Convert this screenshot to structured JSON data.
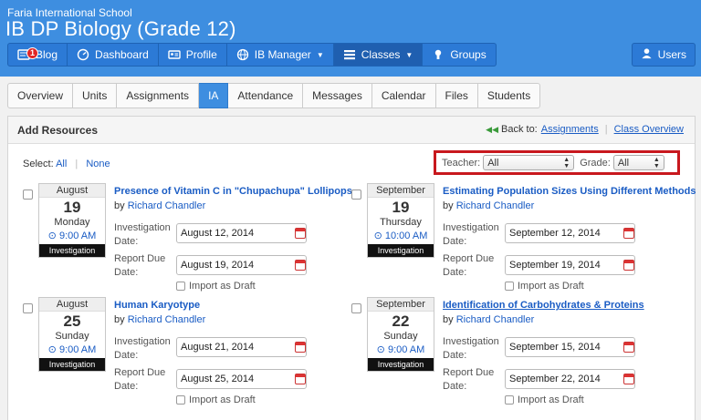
{
  "header": {
    "school": "Faria International School",
    "course": "IB DP Biology (Grade 12)"
  },
  "nav": {
    "items": [
      {
        "label": "Blog",
        "icon": "blog-icon",
        "badge": "1"
      },
      {
        "label": "Dashboard",
        "icon": "dashboard-icon"
      },
      {
        "label": "Profile",
        "icon": "profile-icon"
      },
      {
        "label": "IB Manager",
        "icon": "globe-icon"
      },
      {
        "label": "Classes",
        "icon": "classes-icon"
      },
      {
        "label": "Groups",
        "icon": "groups-icon"
      }
    ],
    "users": "Users"
  },
  "tabs": [
    "Overview",
    "Units",
    "Assignments",
    "IA",
    "Attendance",
    "Messages",
    "Calendar",
    "Files",
    "Students"
  ],
  "panel": {
    "title": "Add Resources",
    "back_to": "Back to:",
    "assignments_link": "Assignments",
    "class_overview_link": "Class Overview",
    "select_label": "Select:",
    "select_all": "All",
    "select_none": "None",
    "teacher_label": "Teacher:",
    "teacher_value": "All",
    "grade_label": "Grade:",
    "grade_value": "All"
  },
  "common": {
    "by": "by",
    "investigation_date_label_1": "Investigation",
    "investigation_date_label_2": "Date:",
    "report_due_label_1": "Report Due",
    "report_due_label_2": "Date:",
    "import_draft": "Import as Draft"
  },
  "items": [
    {
      "month": "August",
      "day": "19",
      "weekday": "Monday",
      "time": "9:00 AM",
      "type": "Investigation",
      "title": "Presence of Vitamin C in \"Chupachupa\" Lollipops",
      "author": "Richard Chandler",
      "investigation_date": "August 12, 2014",
      "report_due_date": "August 19, 2014"
    },
    {
      "month": "September",
      "day": "19",
      "weekday": "Thursday",
      "time": "10:00 AM",
      "type": "Investigation",
      "title": "Estimating Population Sizes Using Different Methods",
      "author": "Richard Chandler",
      "investigation_date": "September 12, 2014",
      "report_due_date": "September 19, 2014"
    },
    {
      "month": "August",
      "day": "25",
      "weekday": "Sunday",
      "time": "9:00 AM",
      "type": "Investigation",
      "title": "Human Karyotype",
      "author": "Richard Chandler",
      "investigation_date": "August 21, 2014",
      "report_due_date": "August 25, 2014"
    },
    {
      "month": "September",
      "day": "22",
      "weekday": "Sunday",
      "time": "9:00 AM",
      "type": "Investigation",
      "title": "Identification of Carbohydrates & Proteins",
      "author": "Richard Chandler",
      "investigation_date": "September 15, 2014",
      "report_due_date": "September 22, 2014"
    }
  ]
}
